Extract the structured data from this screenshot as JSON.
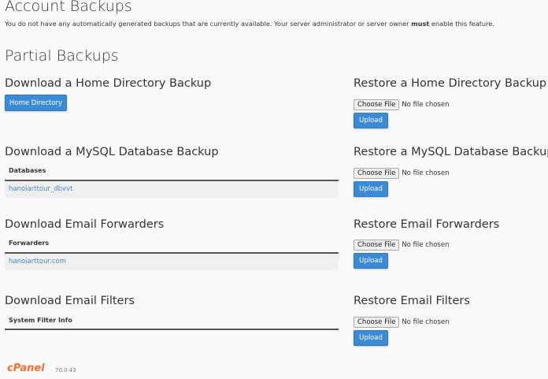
{
  "account_backups": {
    "title": "Account Backups",
    "description_pre": "You do not have any automatically generated backups that are currently available. Your server administrator or server owner ",
    "description_bold": "must",
    "description_post": " enable this feature."
  },
  "partial_backups": {
    "title": "Partial Backups"
  },
  "home": {
    "download_title": "Download a Home Directory Backup",
    "button": "Home Directory",
    "restore_title": "Restore a Home Directory Backup"
  },
  "mysql": {
    "download_title": "Download a MySQL Database Backup",
    "column": "Databases",
    "items": [
      "hanoiarttour_dbvvt"
    ],
    "restore_title": "Restore a MySQL Database Backup"
  },
  "forwarders": {
    "download_title": "Download Email Forwarders",
    "column": "Forwarders",
    "items": [
      "hanoiarttour.com"
    ],
    "restore_title": "Restore Email Forwarders"
  },
  "filters": {
    "download_title": "Download Email Filters",
    "column": "System Filter Info",
    "restore_title": "Restore Email Filters"
  },
  "file_input": {
    "choose": "Choose File",
    "none": "No file chosen"
  },
  "upload_label": "Upload",
  "footer": {
    "logo": "cPanel",
    "version": "70.0.43"
  },
  "colors": {
    "accent": "#3a8ad6",
    "link": "#4a86c8",
    "logo": "#ff6c2c"
  }
}
